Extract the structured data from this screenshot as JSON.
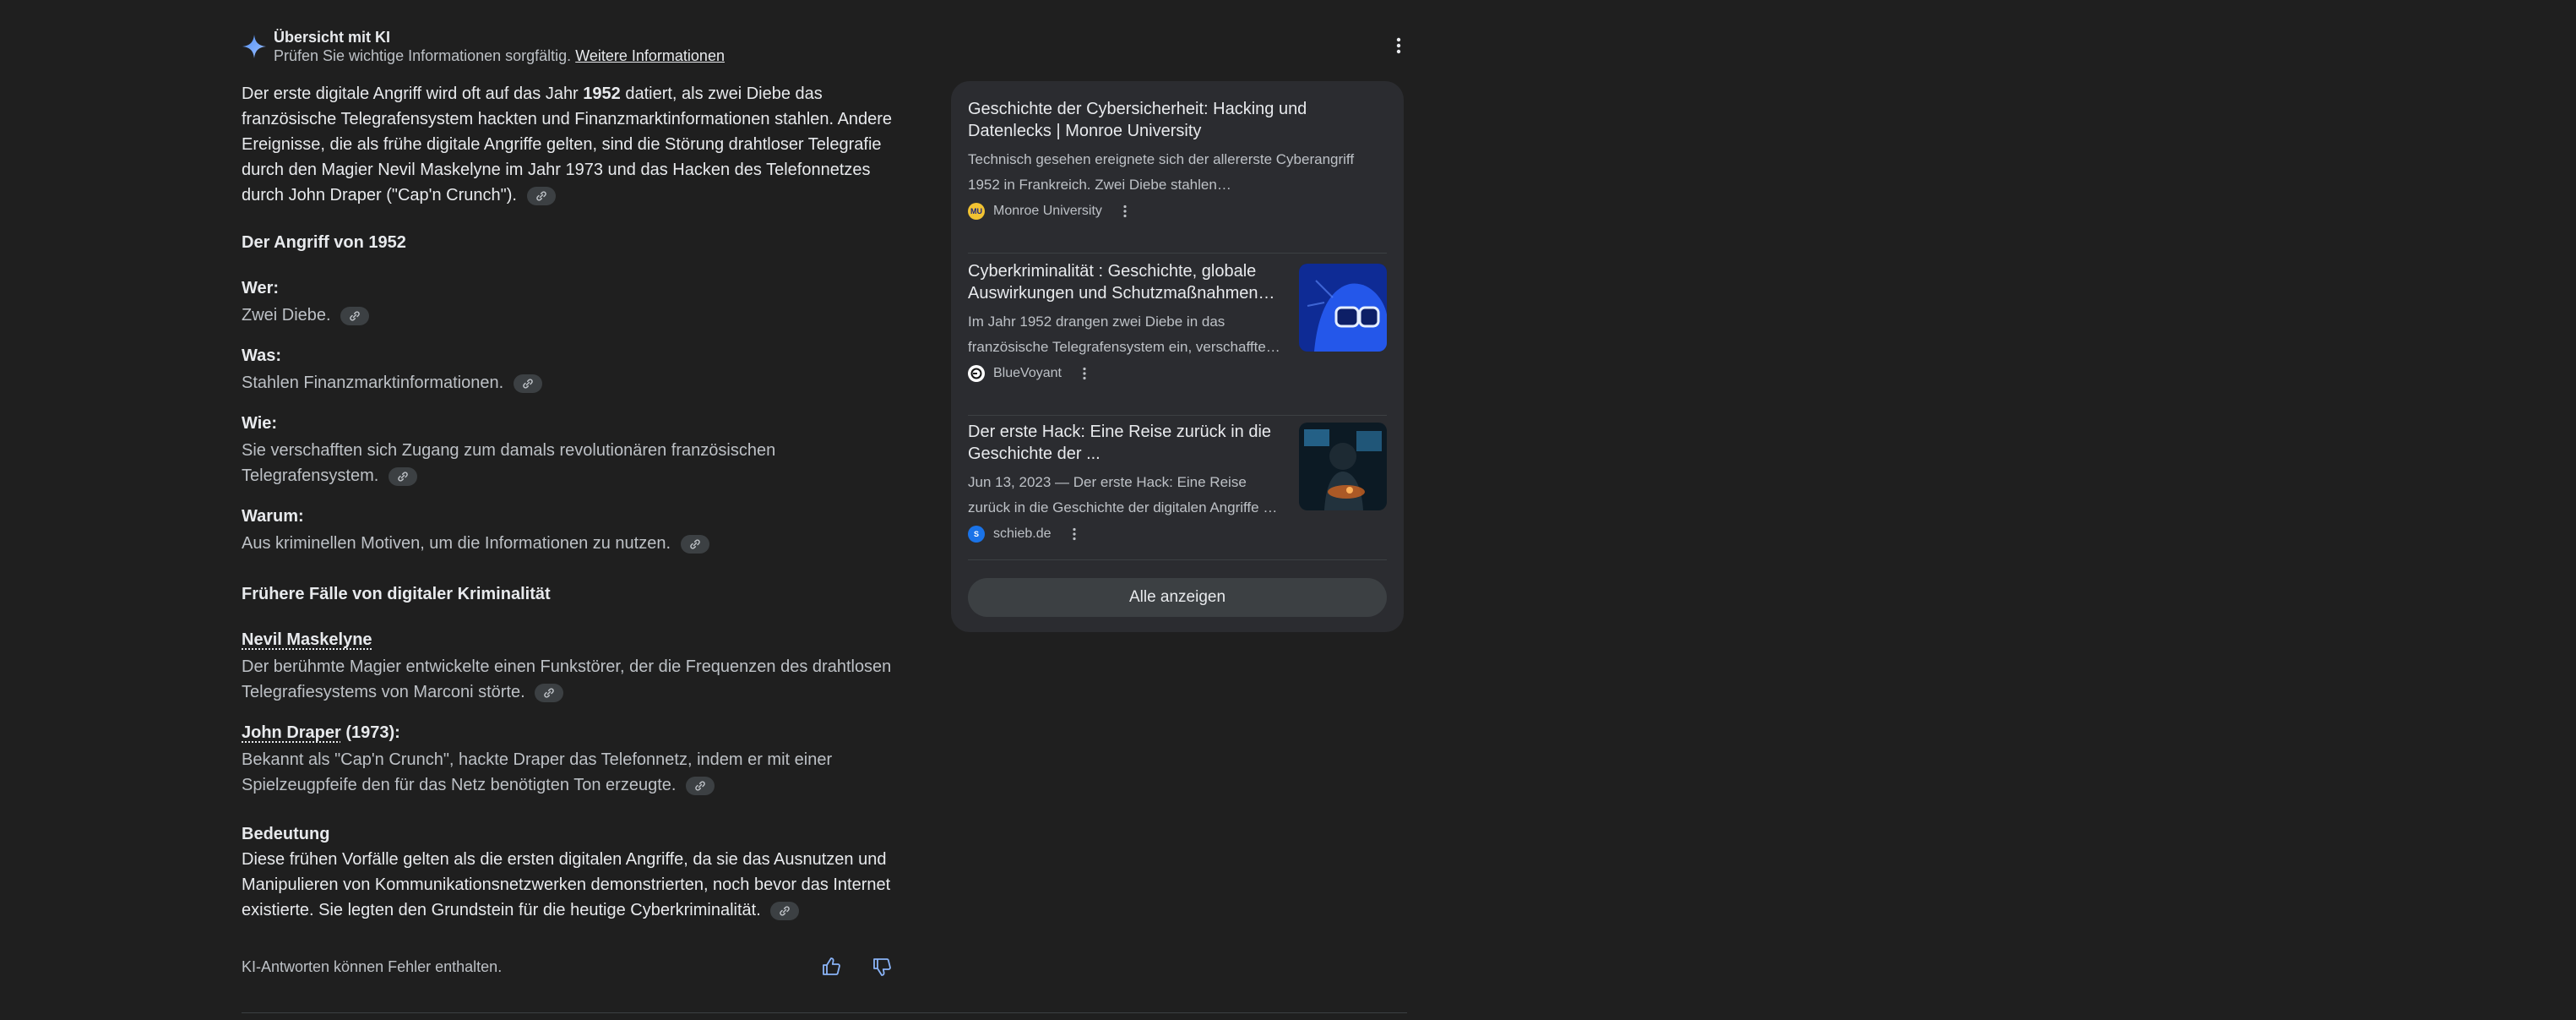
{
  "header": {
    "title": "Übersicht mit KI",
    "subtitle": "Prüfen Sie wichtige Informationen sorgfältig.",
    "link": "Weitere Informationen"
  },
  "intro": {
    "part1": "Der erste digitale Angriff wird oft auf das Jahr ",
    "year": "1952",
    "part2": " datiert, als zwei Diebe das französische Telegrafensystem hackten und Finanzmarktinformationen stahlen. Andere Ereignisse, die als frühe digitale Angriffe gelten, sind die Störung drahtloser Telegrafie durch den Magier Nevil Maskelyne im Jahr 1973 und das Hacken des Telefonnetzes durch John Draper (\"Cap'n Crunch\")."
  },
  "attack": {
    "heading": "Der Angriff von 1952",
    "who_label": "Wer:",
    "who_text": "Zwei Diebe.",
    "what_label": "Was:",
    "what_text": "Stahlen Finanzmarktinformationen.",
    "how_label": "Wie:",
    "how_text": "Sie verschafften sich Zugang zum damals revolutionären französischen Telegrafensystem.",
    "why_label": "Warum:",
    "why_text": "Aus kriminellen Motiven, um die Informationen zu nutzen."
  },
  "early": {
    "heading": "Frühere Fälle von digitaler Kriminalität",
    "maskelyne_name": "Nevil Maskelyne",
    "maskelyne_text": "Der berühmte Magier entwickelte einen Funkstörer, der die Frequenzen des drahtlosen Telegrafiesystems von Marconi störte.",
    "draper_name": "John Draper",
    "draper_suffix": " (1973):",
    "draper_text": "Bekannt als \"Cap'n Crunch\", hackte Draper das Telefonnetz, indem er mit einer Spielzeugpfeife den für das Netz benötigten Ton erzeugte."
  },
  "meaning": {
    "heading": "Bedeutung",
    "text": "Diese frühen Vorfälle gelten als die ersten digitalen Angriffe, da sie das Ausnutzen und Manipulieren von Kommunikationsnetzwerken demonstrierten, noch bevor das Internet existierte. Sie legten den Grundstein für die heutige Cyberkriminalität."
  },
  "footer": {
    "disclaimer": "KI-Antworten können Fehler enthalten."
  },
  "sources": [
    {
      "title": "Geschichte der Cybersicherheit: Hacking und Datenlecks | Monroe University",
      "snippet": "Technisch gesehen ereignete sich der allererste Cyberangriff 1952 in Frankreich. Zwei Diebe stahlen…",
      "site": "Monroe University",
      "favicon_text": "MU"
    },
    {
      "title": "Cyberkriminalität : Geschichte, globale Auswirkungen und Schutzmaßnahmen…",
      "snippet": "Im Jahr 1952 drangen zwei Diebe in das französische Telegrafensystem ein, verschaffte…",
      "site": "BlueVoyant",
      "favicon_text": ""
    },
    {
      "title": "Der erste Hack: Eine Reise zurück in die Geschichte der ...",
      "snippet": "Jun 13, 2023 — Der erste Hack: Eine Reise zurück in die Geschichte der digitalen Angriffe …",
      "site": "schieb.de",
      "favicon_text": "S"
    }
  ],
  "show_all": "Alle anzeigen",
  "colors": {
    "background": "#1f1f1f",
    "panel": "#2b2c30",
    "chip": "#3c4043",
    "accent": "#8ab4f8"
  }
}
